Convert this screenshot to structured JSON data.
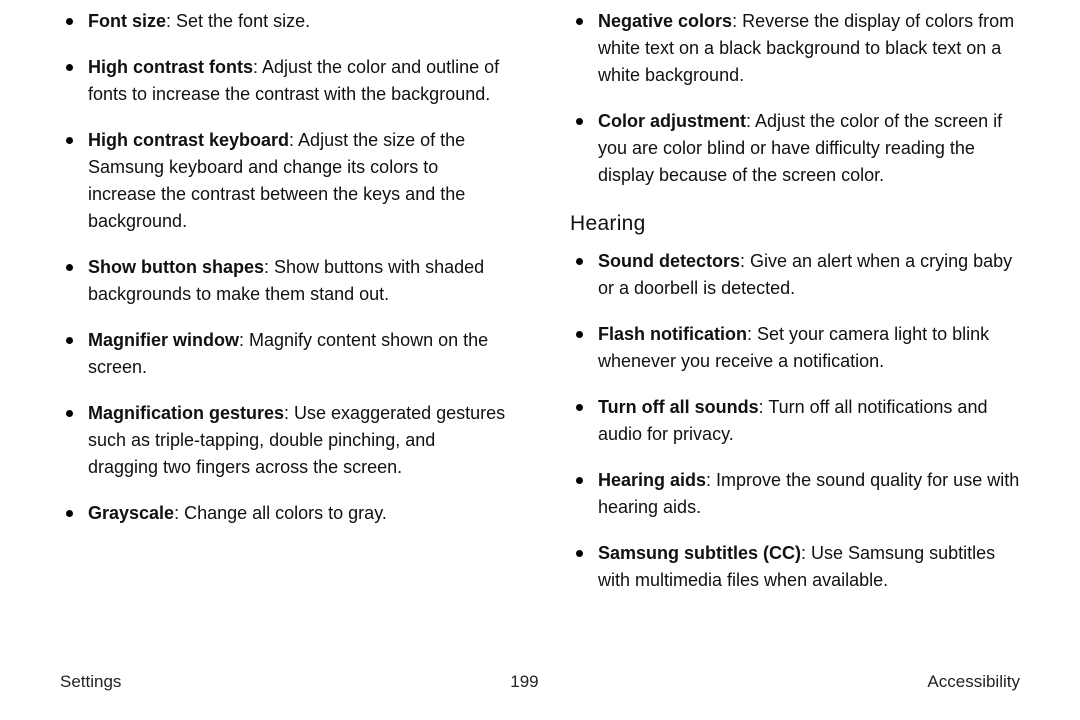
{
  "left_column": {
    "items": [
      {
        "term": "Font size",
        "desc": ": Set the font size."
      },
      {
        "term": "High contrast fonts",
        "desc": ": Adjust the color and outline of fonts to increase the contrast with the background."
      },
      {
        "term": "High contrast keyboard",
        "desc": ": Adjust the size of the Samsung keyboard and change its colors to increase the contrast between the keys and the background."
      },
      {
        "term": "Show button shapes",
        "desc": ": Show buttons with shaded backgrounds to make them stand out."
      },
      {
        "term": "Magnifier window",
        "desc": ": Magnify content shown on the screen."
      },
      {
        "term": "Magnification gestures",
        "desc": ": Use exaggerated gestures such as triple-tapping, double pinching, and dragging two fingers across the screen."
      },
      {
        "term": "Grayscale",
        "desc": ": Change all colors to gray."
      }
    ]
  },
  "right_column": {
    "top_items": [
      {
        "term": "Negative colors",
        "desc": ": Reverse the display of colors from white text on a black background to black text on a white background."
      },
      {
        "term": "Color adjustment",
        "desc": ": Adjust the color of the screen if you are color blind or have difficulty reading the display because of the screen color."
      }
    ],
    "section_heading": "Hearing",
    "hearing_items": [
      {
        "term": "Sound detectors",
        "desc": ": Give an alert when a crying baby or a doorbell is detected."
      },
      {
        "term": "Flash notification",
        "desc": ": Set your camera light to blink whenever you receive a notification."
      },
      {
        "term": "Turn off all sounds",
        "desc": ": Turn off all notifications and audio for privacy."
      },
      {
        "term": "Hearing aids",
        "desc": ": Improve the sound quality for use with hearing aids."
      },
      {
        "term": "Samsung subtitles (CC)",
        "desc": ": Use Samsung subtitles with multimedia files when available."
      }
    ]
  },
  "footer": {
    "left": "Settings",
    "center": "199",
    "right": "Accessibility"
  }
}
